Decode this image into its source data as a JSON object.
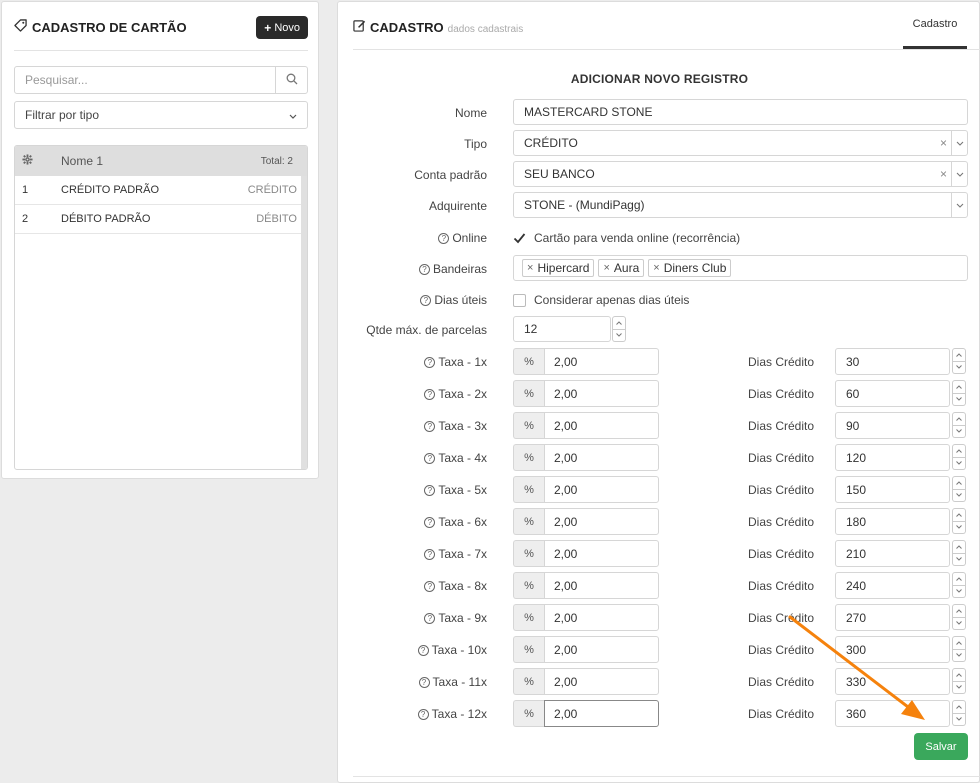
{
  "left": {
    "title": "CADASTRO DE CARTÃO",
    "new_button": "Novo",
    "search_placeholder": "Pesquisar...",
    "filter_label": "Filtrar por tipo",
    "table": {
      "header_name": "Nome 1",
      "header_total": "Total: 2",
      "rows": [
        {
          "num": "1",
          "name": "CRÉDITO PADRÃO",
          "type": "CRÉDITO"
        },
        {
          "num": "2",
          "name": "DÉBITO PADRÃO",
          "type": "DÉBITO"
        }
      ]
    }
  },
  "right": {
    "title": "CADASTRO",
    "subtitle": "dados cadastrais",
    "tab": "Cadastro",
    "form_title": "ADICIONAR NOVO REGISTRO",
    "fields": {
      "nome_label": "Nome",
      "nome_value": "MASTERCARD STONE",
      "tipo_label": "Tipo",
      "tipo_value": "CRÉDITO",
      "conta_label": "Conta padrão",
      "conta_value": "SEU BANCO",
      "adquirente_label": "Adquirente",
      "adquirente_value": "STONE - (MundiPagg)",
      "online_label": "Online",
      "online_check_label": "Cartão para venda online (recorrência)",
      "online_checked": true,
      "bandeiras_label": "Bandeiras",
      "bandeiras": [
        "Hipercard",
        "Aura",
        "Diners Club"
      ],
      "dias_uteis_label": "Dias úteis",
      "dias_uteis_check_label": "Considerar apenas dias úteis",
      "dias_uteis_checked": false,
      "parcelas_label": "Qtde máx. de parcelas",
      "parcelas_value": "12"
    },
    "rates": [
      {
        "label": "Taxa - 1x",
        "pct": "2,00",
        "dias_label": "Dias Crédito",
        "dias": "30"
      },
      {
        "label": "Taxa - 2x",
        "pct": "2,00",
        "dias_label": "Dias Crédito",
        "dias": "60"
      },
      {
        "label": "Taxa - 3x",
        "pct": "2,00",
        "dias_label": "Dias Crédito",
        "dias": "90"
      },
      {
        "label": "Taxa - 4x",
        "pct": "2,00",
        "dias_label": "Dias Crédito",
        "dias": "120"
      },
      {
        "label": "Taxa - 5x",
        "pct": "2,00",
        "dias_label": "Dias Crédito",
        "dias": "150"
      },
      {
        "label": "Taxa - 6x",
        "pct": "2,00",
        "dias_label": "Dias Crédito",
        "dias": "180"
      },
      {
        "label": "Taxa - 7x",
        "pct": "2,00",
        "dias_label": "Dias Crédito",
        "dias": "210"
      },
      {
        "label": "Taxa - 8x",
        "pct": "2,00",
        "dias_label": "Dias Crédito",
        "dias": "240"
      },
      {
        "label": "Taxa - 9x",
        "pct": "2,00",
        "dias_label": "Dias Crédito",
        "dias": "270"
      },
      {
        "label": "Taxa - 10x",
        "pct": "2,00",
        "dias_label": "Dias Crédito",
        "dias": "300"
      },
      {
        "label": "Taxa - 11x",
        "pct": "2,00",
        "dias_label": "Dias Crédito",
        "dias": "330"
      },
      {
        "label": "Taxa - 12x",
        "pct": "2,00",
        "dias_label": "Dias Crédito",
        "dias": "360"
      }
    ],
    "pct_symbol": "%",
    "save_button": "Salvar"
  },
  "colors": {
    "accent_dark": "#2a2a2a",
    "save_green": "#3aa85c",
    "arrow_orange": "#f5820d"
  }
}
